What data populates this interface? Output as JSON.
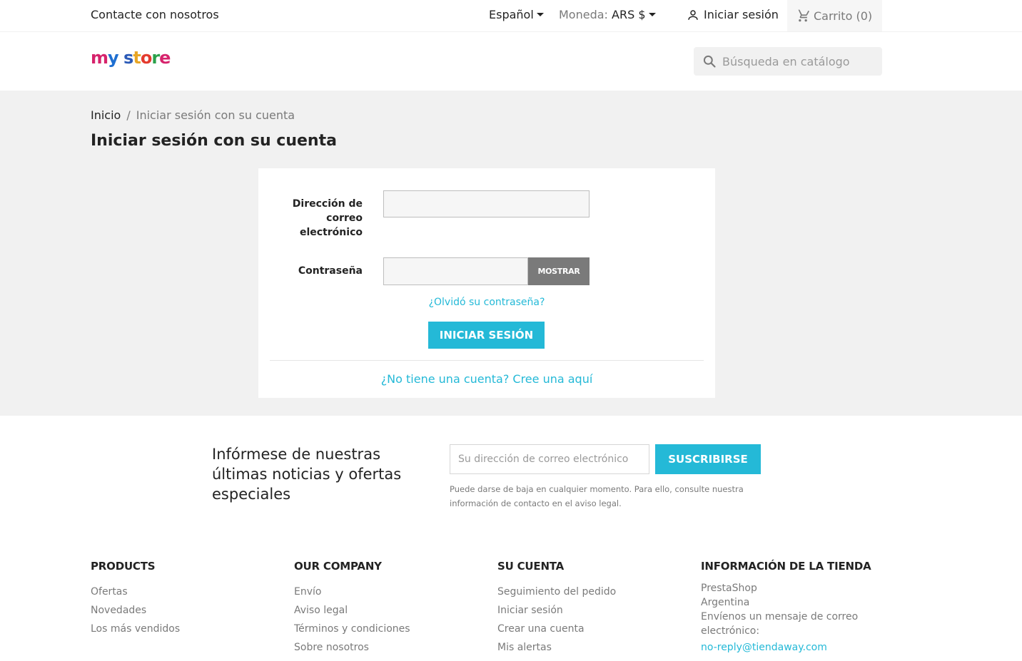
{
  "topnav": {
    "contact": "Contacte con nosotros",
    "language": "Español",
    "currency_label": "Moneda:",
    "currency_value": "ARS $",
    "signin": "Iniciar sesión",
    "cart": "Carrito (0)"
  },
  "header": {
    "logo": "my store",
    "search_placeholder": "Búsqueda en catálogo"
  },
  "breadcrumb": {
    "home": "Inicio",
    "separator": "/",
    "current": "Iniciar sesión con su cuenta"
  },
  "page_title": "Iniciar sesión con su cuenta",
  "login_form": {
    "email_label": "Dirección de correo electrónico",
    "password_label": "Contraseña",
    "show_button": "MOSTRAR",
    "forgot_link": "¿Olvidó su contraseña?",
    "submit_button": "INICIAR SESIÓN",
    "create_account_link": "¿No tiene una cuenta? Cree una aquí"
  },
  "newsletter": {
    "title": "Infórmese de nuestras últimas noticias y ofertas especiales",
    "email_placeholder": "Su dirección de correo electrónico",
    "subscribe_button": "SUSCRIBIRSE",
    "note": "Puede darse de baja en cualquier momento. Para ello, consulte nuestra información de contacto en el aviso legal."
  },
  "footer": {
    "products": {
      "title": "PRODUCTS",
      "links": [
        "Ofertas",
        "Novedades",
        "Los más vendidos"
      ]
    },
    "company": {
      "title": "OUR COMPANY",
      "links": [
        "Envío",
        "Aviso legal",
        "Términos y condiciones",
        "Sobre nosotros"
      ]
    },
    "account": {
      "title": "SU CUENTA",
      "links": [
        "Seguimiento del pedido",
        "Iniciar sesión",
        "Crear una cuenta",
        "Mis alertas"
      ]
    },
    "store": {
      "title": "INFORMACIÓN DE LA TIENDA",
      "line1": "PrestaShop",
      "line2": "Argentina",
      "email_prefix": "Envíenos un mensaje de correo electrónico:",
      "email": "no-reply@tiendaway.com"
    }
  },
  "colors": {
    "accent": "#24b9d7",
    "background": "#f1f1f1",
    "text": "#232323",
    "muted": "#7a7a7a"
  },
  "icons": {
    "signin": "person-icon",
    "cart": "shopping-cart-icon",
    "search": "search-icon",
    "dropdown": "caret-down-icon"
  }
}
